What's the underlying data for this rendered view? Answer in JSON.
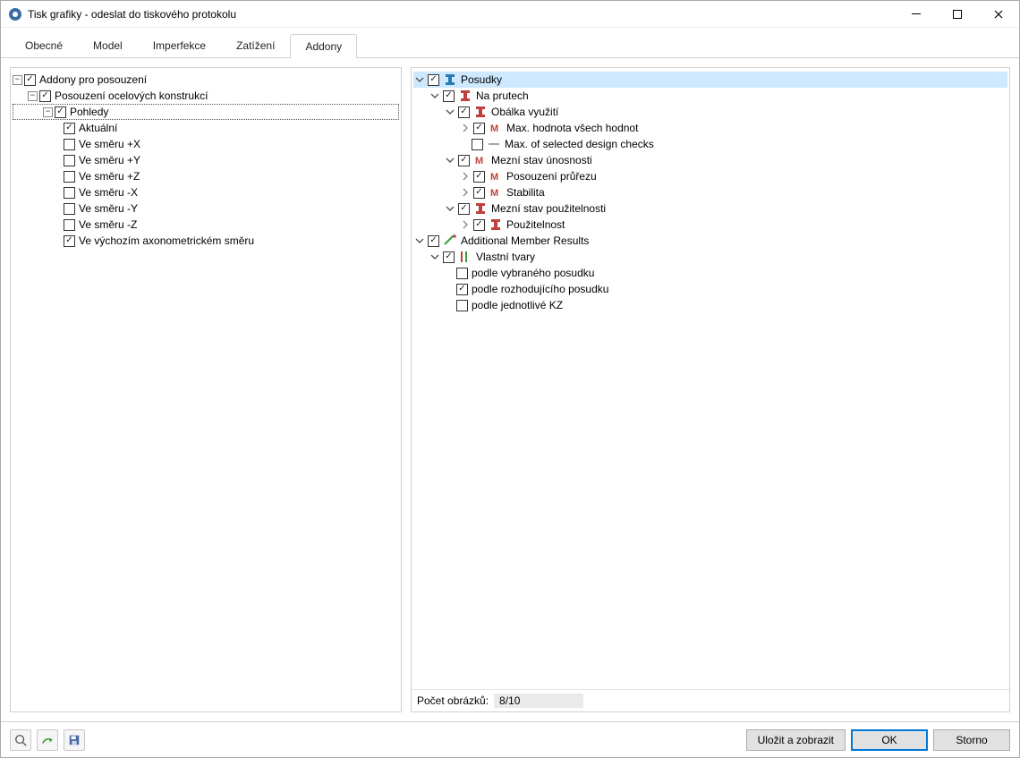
{
  "window": {
    "title": "Tisk grafiky - odeslat do tiskového protokolu"
  },
  "tabs": {
    "items": [
      "Obecné",
      "Model",
      "Imperfekce",
      "Zatížení",
      "Addony"
    ],
    "active_index": 4
  },
  "left_tree": {
    "n0": "Addony pro posouzení",
    "n1": "Posouzení ocelových konstrukcí",
    "n2": "Pohledy",
    "n3": "Aktuální",
    "n4": "Ve směru +X",
    "n5": "Ve směru +Y",
    "n6": "Ve směru +Z",
    "n7": "Ve směru -X",
    "n8": "Ve směru -Y",
    "n9": "Ve směru -Z",
    "n10": "Ve výchozím axonometrickém směru"
  },
  "right_tree": {
    "r0": "Posudky",
    "r1": "Na prutech",
    "r2": "Obálka využití",
    "r3": "Max. hodnota všech hodnot",
    "r4": "Max. of selected design checks",
    "r5": "Mezní stav únosnosti",
    "r6": "Posouzení průřezu",
    "r7": "Stabilita",
    "r8": "Mezní stav použitelnosti",
    "r9": "Použitelnost",
    "r10": "Additional Member Results",
    "r11": "Vlastní tvary",
    "r12": "podle vybraného posudku",
    "r13": "podle rozhodujícího posudku",
    "r14": "podle jednotlivé KZ"
  },
  "count": {
    "label": "Počet obrázků:",
    "value": "8/10"
  },
  "footer": {
    "save_show": "Uložit a zobrazit",
    "ok": "OK",
    "cancel": "Storno"
  }
}
